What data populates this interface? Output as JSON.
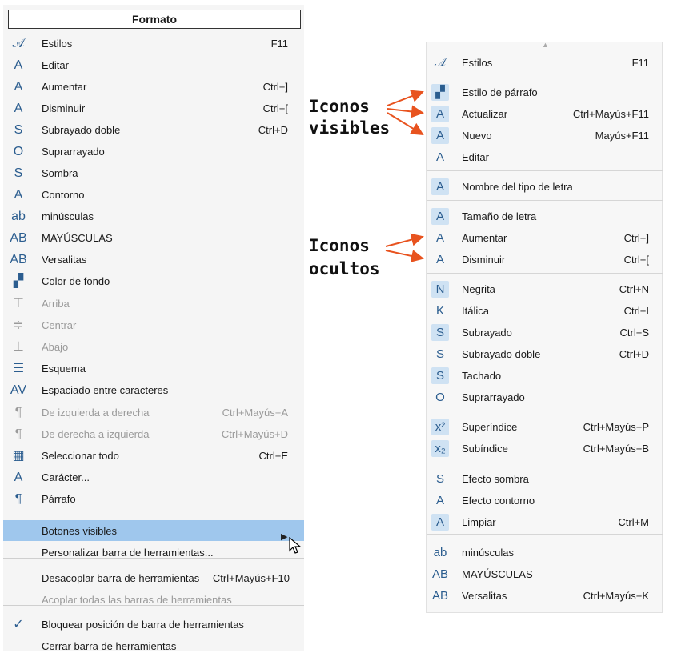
{
  "left_menu": {
    "title": "Formato",
    "items": [
      {
        "label": "Estilos",
        "shortcut": "F11",
        "icon": "styles-icon",
        "glyph": "𝒜"
      },
      {
        "label": "Editar",
        "shortcut": "",
        "icon": "edit-style-icon",
        "glyph": "A"
      },
      {
        "label": "Aumentar",
        "shortcut": "Ctrl+]",
        "icon": "grow-font-icon",
        "glyph": "A"
      },
      {
        "label": "Disminuir",
        "shortcut": "Ctrl+[",
        "icon": "shrink-font-icon",
        "glyph": "A"
      },
      {
        "label": "Subrayado doble",
        "shortcut": "Ctrl+D",
        "icon": "double-underline-icon",
        "glyph": "S"
      },
      {
        "label": "Suprarrayado",
        "shortcut": "",
        "icon": "overline-icon",
        "glyph": "O"
      },
      {
        "label": "Sombra",
        "shortcut": "",
        "icon": "shadow-icon",
        "glyph": "S"
      },
      {
        "label": "Contorno",
        "shortcut": "",
        "icon": "outline-icon",
        "glyph": "A"
      },
      {
        "label": "minúsculas",
        "shortcut": "",
        "icon": "lowercase-icon",
        "glyph": "ab"
      },
      {
        "label": "MAYÚSCULAS",
        "shortcut": "",
        "icon": "uppercase-icon",
        "glyph": "AB"
      },
      {
        "label": "Versalitas",
        "shortcut": "",
        "icon": "small-caps-icon",
        "glyph": "AB"
      },
      {
        "label": "Color de fondo",
        "shortcut": "",
        "icon": "background-color-icon",
        "glyph": "▞"
      },
      {
        "label": "Arriba",
        "shortcut": "",
        "icon": "align-top-icon",
        "glyph": "⊤",
        "disabled": true
      },
      {
        "label": "Centrar",
        "shortcut": "",
        "icon": "align-middle-icon",
        "glyph": "≑",
        "disabled": true
      },
      {
        "label": "Abajo",
        "shortcut": "",
        "icon": "align-bottom-icon",
        "glyph": "⊥",
        "disabled": true
      },
      {
        "label": "Esquema",
        "shortcut": "",
        "icon": "outline-list-icon",
        "glyph": "☰"
      },
      {
        "label": "Espaciado entre caracteres",
        "shortcut": "",
        "icon": "char-spacing-icon",
        "glyph": "AV"
      },
      {
        "label": "De izquierda a derecha",
        "shortcut": "Ctrl+Mayús+A",
        "icon": "ltr-icon",
        "glyph": "¶",
        "disabled": true
      },
      {
        "label": "De derecha a izquierda",
        "shortcut": "Ctrl+Mayús+D",
        "icon": "rtl-icon",
        "glyph": "¶",
        "disabled": true
      },
      {
        "label": "Seleccionar todo",
        "shortcut": "Ctrl+E",
        "icon": "select-all-icon",
        "glyph": "▦"
      },
      {
        "label": "Carácter...",
        "shortcut": "",
        "icon": "character-icon",
        "glyph": "A"
      },
      {
        "label": "Párrafo",
        "shortcut": "",
        "icon": "paragraph-icon",
        "glyph": "¶"
      },
      {
        "label": "Botones visibles",
        "shortcut": "",
        "icon": "",
        "glyph": "",
        "highlight": true
      },
      {
        "label": "Personalizar barra de herramientas...",
        "shortcut": "",
        "icon": "",
        "glyph": ""
      },
      {
        "label": "Desacoplar barra de herramientas",
        "shortcut": "Ctrl+Mayús+F10",
        "icon": "",
        "glyph": ""
      },
      {
        "label": "Acoplar todas las barras de herramientas",
        "shortcut": "",
        "icon": "",
        "glyph": "",
        "disabled": true
      },
      {
        "label": "Bloquear posición de barra de herramientas",
        "shortcut": "",
        "icon": "checkmark-icon",
        "glyph": "✓"
      },
      {
        "label": "Cerrar barra de herramientas",
        "shortcut": "",
        "icon": "",
        "glyph": ""
      }
    ]
  },
  "annotations": {
    "visible_line1": "Iconos",
    "visible_line2": "visibles",
    "hidden_line1": "Iconos",
    "hidden_line2": "ocultos"
  },
  "right_menu": {
    "items": [
      {
        "label": "Estilos",
        "shortcut": "F11",
        "icon": "styles-icon",
        "glyph": "𝒜",
        "boxed": false
      },
      {
        "label": "Estilo de párrafo",
        "shortcut": "",
        "icon": "paragraph-style-icon",
        "glyph": "▞",
        "boxed": true
      },
      {
        "label": "Actualizar",
        "shortcut": "Ctrl+Mayús+F11",
        "icon": "update-style-icon",
        "glyph": "A",
        "boxed": true
      },
      {
        "label": "Nuevo",
        "shortcut": "Mayús+F11",
        "icon": "new-style-icon",
        "glyph": "A",
        "boxed": true
      },
      {
        "label": "Editar",
        "shortcut": "",
        "icon": "edit-style-icon",
        "glyph": "A",
        "boxed": false
      },
      {
        "label": "Nombre del tipo de letra",
        "shortcut": "",
        "icon": "font-name-icon",
        "glyph": "A",
        "boxed": true
      },
      {
        "label": "Tamaño de letra",
        "shortcut": "",
        "icon": "font-size-icon",
        "glyph": "A",
        "boxed": true
      },
      {
        "label": "Aumentar",
        "shortcut": "Ctrl+]",
        "icon": "grow-font-icon",
        "glyph": "A",
        "boxed": false
      },
      {
        "label": "Disminuir",
        "shortcut": "Ctrl+[",
        "icon": "shrink-font-icon",
        "glyph": "A",
        "boxed": false
      },
      {
        "label": "Negrita",
        "shortcut": "Ctrl+N",
        "icon": "bold-icon",
        "glyph": "N",
        "boxed": true
      },
      {
        "label": "Itálica",
        "shortcut": "Ctrl+I",
        "icon": "italic-icon",
        "glyph": "K",
        "boxed": false
      },
      {
        "label": "Subrayado",
        "shortcut": "Ctrl+S",
        "icon": "underline-icon",
        "glyph": "S",
        "boxed": true
      },
      {
        "label": "Subrayado doble",
        "shortcut": "Ctrl+D",
        "icon": "double-underline-icon",
        "glyph": "S",
        "boxed": false
      },
      {
        "label": "Tachado",
        "shortcut": "",
        "icon": "strikethrough-icon",
        "glyph": "S",
        "boxed": true
      },
      {
        "label": "Suprarrayado",
        "shortcut": "",
        "icon": "overline-icon",
        "glyph": "O",
        "boxed": false
      },
      {
        "label": "Superíndice",
        "shortcut": "Ctrl+Mayús+P",
        "icon": "superscript-icon",
        "glyph": "x²",
        "boxed": true
      },
      {
        "label": "Subíndice",
        "shortcut": "Ctrl+Mayús+B",
        "icon": "subscript-icon",
        "glyph": "x₂",
        "boxed": true
      },
      {
        "label": "Efecto sombra",
        "shortcut": "",
        "icon": "shadow-icon",
        "glyph": "S",
        "boxed": false
      },
      {
        "label": "Efecto contorno",
        "shortcut": "",
        "icon": "outline-icon",
        "glyph": "A",
        "boxed": false
      },
      {
        "label": "Limpiar",
        "shortcut": "Ctrl+M",
        "icon": "clear-formatting-icon",
        "glyph": "A",
        "boxed": true
      },
      {
        "label": "minúsculas",
        "shortcut": "",
        "icon": "lowercase-icon",
        "glyph": "ab",
        "boxed": false
      },
      {
        "label": "MAYÚSCULAS",
        "shortcut": "",
        "icon": "uppercase-icon",
        "glyph": "AB",
        "boxed": false
      },
      {
        "label": "Versalitas",
        "shortcut": "Ctrl+Mayús+K",
        "icon": "small-caps-icon",
        "glyph": "AB",
        "boxed": false
      }
    ]
  },
  "colors": {
    "highlight": "#9fc7ed",
    "arrow": "#e8531f",
    "icon": "#2b5d8f"
  }
}
